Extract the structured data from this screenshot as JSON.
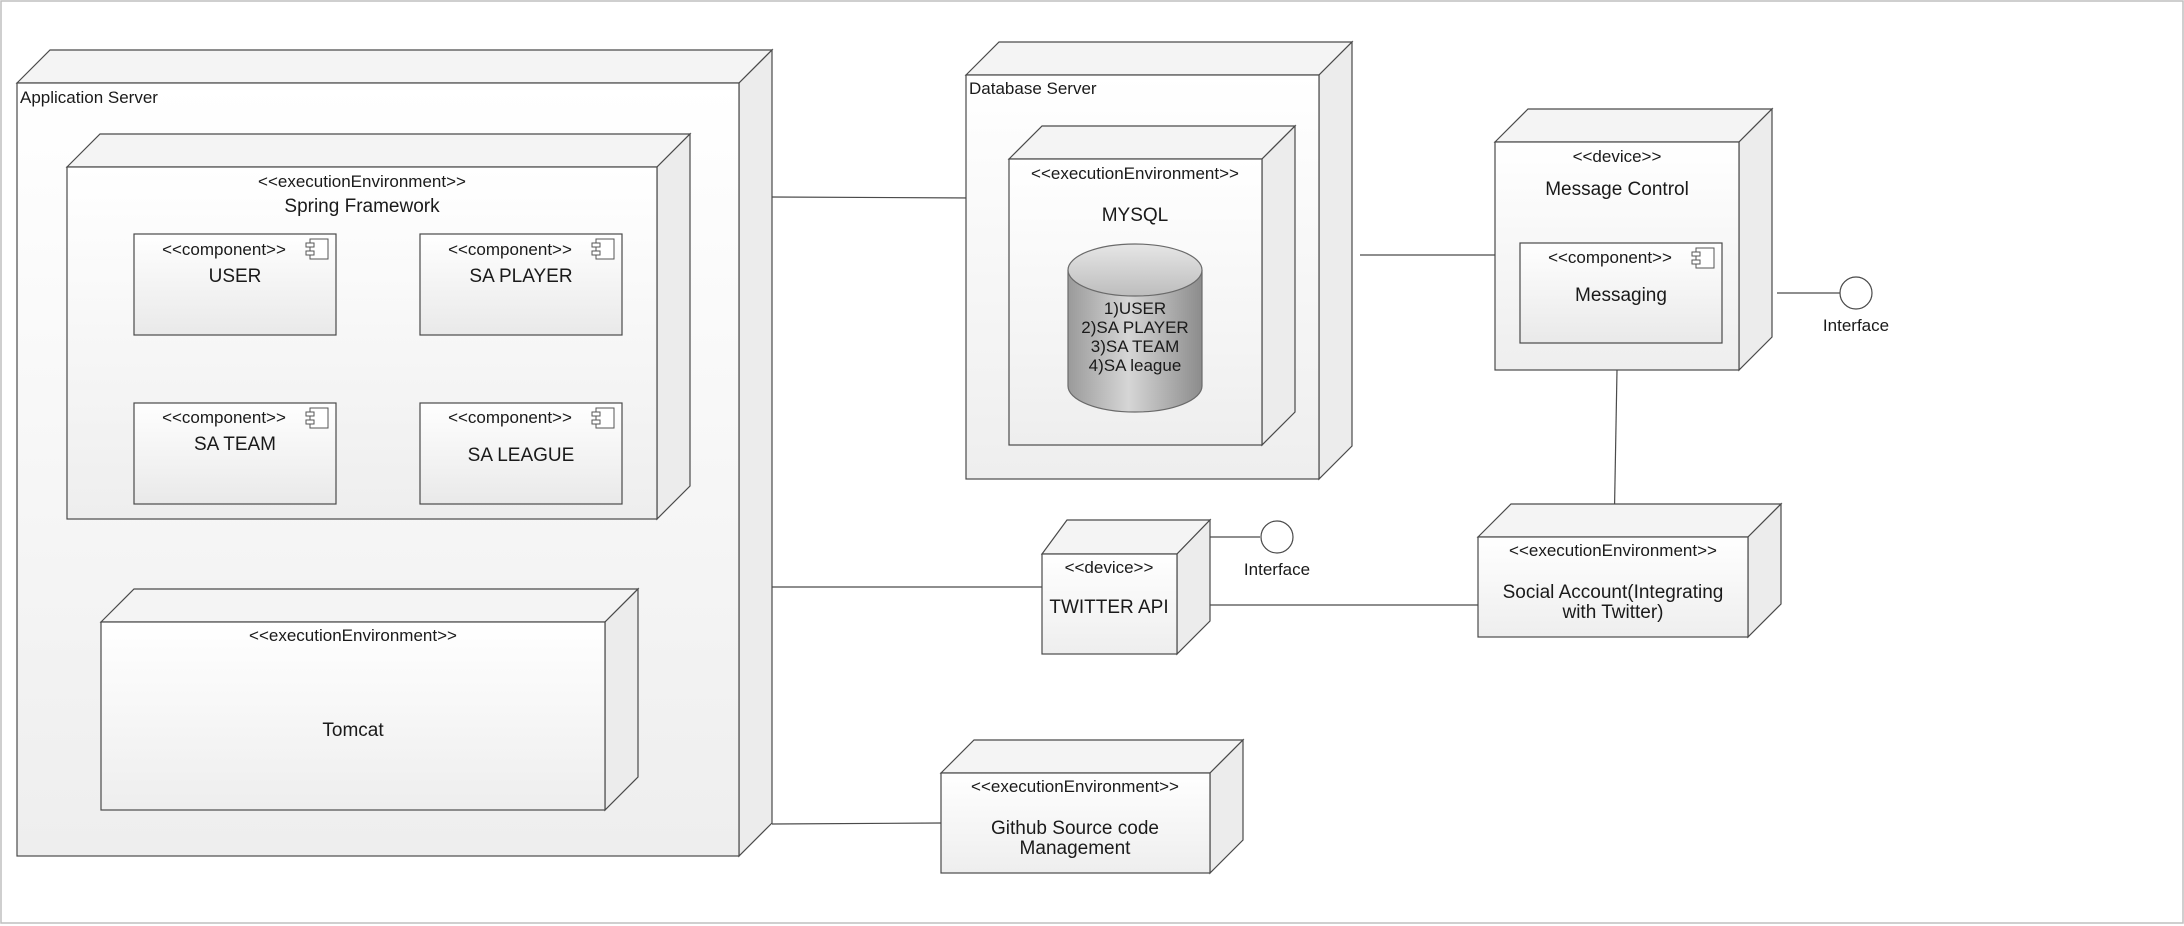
{
  "nodes": {
    "app_server": {
      "title": "Application Server"
    },
    "spring": {
      "stereotype": "<<executionEnvironment>>",
      "name": "Spring Framework"
    },
    "comp_user": {
      "stereotype": "<<component>>",
      "name": "USER"
    },
    "comp_player": {
      "stereotype": "<<component>>",
      "name": "SA PLAYER"
    },
    "comp_team": {
      "stereotype": "<<component>>",
      "name": "SA TEAM"
    },
    "comp_league": {
      "stereotype": "<<component>>",
      "name": "SA LEAGUE"
    },
    "tomcat": {
      "stereotype": "<<executionEnvironment>>",
      "name": "Tomcat"
    },
    "db_server": {
      "title": "Database Server"
    },
    "mysql": {
      "stereotype": "<<executionEnvironment>>",
      "name": "MYSQL",
      "tables": [
        "1)USER",
        "2)SA PLAYER",
        "3)SA TEAM",
        "4)SA league"
      ]
    },
    "msg_control": {
      "stereotype": "<<device>>",
      "name": "Message Control"
    },
    "messaging": {
      "stereotype": "<<component>>",
      "name": "Messaging"
    },
    "twitter": {
      "stereotype": "<<device>>",
      "name": "TWITTER API"
    },
    "social": {
      "stereotype": "<<executionEnvironment>>",
      "name_line1": "Social Account(Integrating",
      "name_line2": "with Twitter)"
    },
    "github": {
      "stereotype": "<<executionEnvironment>>",
      "name_line1": "Github Source code",
      "name_line2": "Management"
    }
  },
  "interfaces": {
    "twitter_interface": "Interface",
    "messaging_interface": "Interface"
  }
}
